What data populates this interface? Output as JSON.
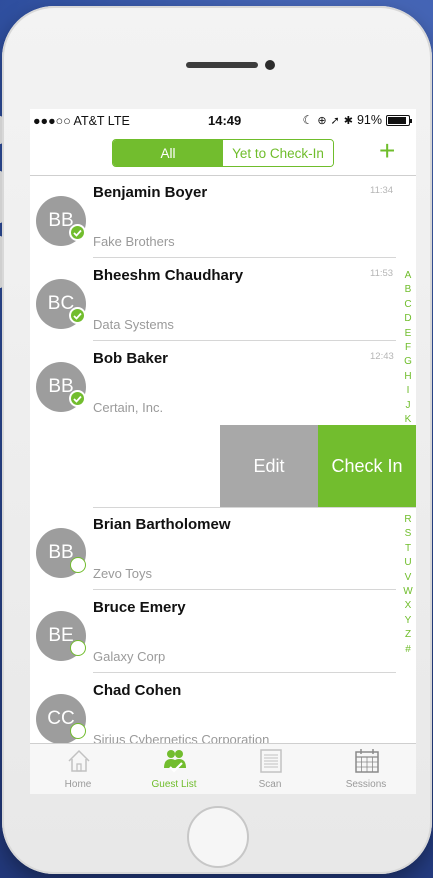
{
  "status_bar": {
    "carrier": "●●●○○ AT&T  LTE",
    "time": "14:49",
    "battery": "91%"
  },
  "header": {
    "segments": [
      "All",
      "Yet to Check-In"
    ],
    "selected_segment": "All",
    "add_label": "+"
  },
  "guests": [
    {
      "initials": "BB",
      "name": "Benjamin Boyer",
      "company": "Fake Brothers",
      "time": "11:34",
      "checked_in": true
    },
    {
      "initials": "BC",
      "name": "Bheeshm Chaudhary",
      "company": "Data Systems",
      "time": "11:53",
      "checked_in": true
    },
    {
      "initials": "BB",
      "name": "Bob Baker",
      "company": "Certain, Inc.",
      "time": "12:43",
      "checked_in": true
    },
    {
      "initials": "BB",
      "name": "Brian Bartholomew",
      "company": "Zevo Toys",
      "time": "",
      "checked_in": false
    },
    {
      "initials": "BE",
      "name": "Bruce Emery",
      "company": "Galaxy Corp",
      "time": "",
      "checked_in": false
    },
    {
      "initials": "CC",
      "name": "Chad Cohen",
      "company": "Sirius Cybernetics Corporation",
      "time": "",
      "checked_in": false
    }
  ],
  "swipe_actions": {
    "edit": "Edit",
    "check_in": "Check In"
  },
  "index_upper": [
    "A",
    "B",
    "C",
    "D",
    "E",
    "F",
    "G",
    "H",
    "I",
    "J",
    "K"
  ],
  "index_lower": [
    "R",
    "S",
    "T",
    "U",
    "V",
    "W",
    "X",
    "Y",
    "Z",
    "#"
  ],
  "tabs": [
    {
      "label": "Home",
      "icon": "home-icon",
      "active": false
    },
    {
      "label": "Guest List",
      "icon": "guest-list-icon",
      "active": true
    },
    {
      "label": "Scan",
      "icon": "scan-icon",
      "active": false
    },
    {
      "label": "Sessions",
      "icon": "calendar-icon",
      "active": false
    }
  ],
  "colors": {
    "accent": "#72bd2e",
    "avatar": "#9d9d9d",
    "edit": "#a8a8a8"
  }
}
